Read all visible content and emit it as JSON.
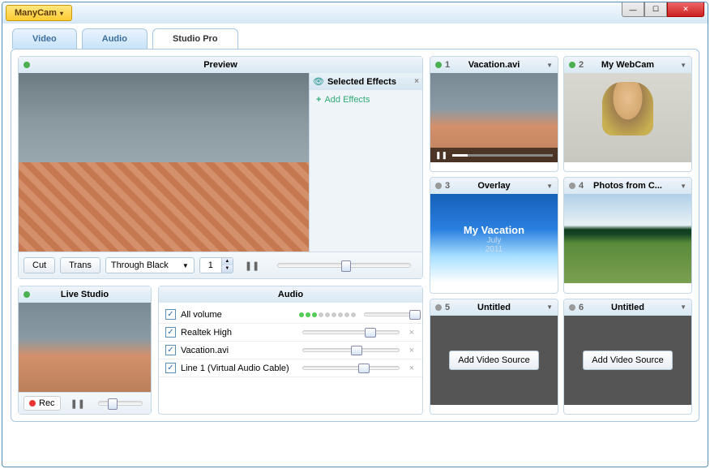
{
  "app_name": "ManyCam",
  "tabs": [
    "Video",
    "Audio",
    "Studio Pro"
  ],
  "active_tab": 2,
  "preview": {
    "title": "Preview",
    "effects_panel": {
      "title": "Selected Effects",
      "add_label": "Add Effects"
    },
    "toolbar": {
      "cut": "Cut",
      "trans": "Trans",
      "transition": "Through Black",
      "count": "1"
    }
  },
  "sources": [
    {
      "num": "1",
      "title": "Vacation.avi",
      "active": true,
      "kind": "video"
    },
    {
      "num": "2",
      "title": "My WebCam",
      "active": true,
      "kind": "webcam"
    },
    {
      "num": "3",
      "title": "Overlay",
      "active": false,
      "kind": "overlay",
      "overlay": {
        "t1": "My Vacation",
        "t2": "July",
        "t3": "2011"
      }
    },
    {
      "num": "4",
      "title": "Photos from C...",
      "active": false,
      "kind": "nature"
    },
    {
      "num": "5",
      "title": "Untitled",
      "active": false,
      "kind": "empty",
      "btn": "Add Video Source"
    },
    {
      "num": "6",
      "title": "Untitled",
      "active": false,
      "kind": "empty",
      "btn": "Add Video Source"
    }
  ],
  "live_studio": {
    "title": "Live Studio",
    "rec": "Rec"
  },
  "audio": {
    "title": "Audio",
    "rows": [
      {
        "name": "All volume",
        "checked": true,
        "level": 3,
        "thumb": 95,
        "master": true
      },
      {
        "name": "Realtek High",
        "checked": true,
        "thumb": 65
      },
      {
        "name": "Vacation.avi",
        "checked": true,
        "thumb": 50
      },
      {
        "name": "Line 1 (Virtual Audio Cable)",
        "checked": true,
        "thumb": 58
      }
    ]
  }
}
